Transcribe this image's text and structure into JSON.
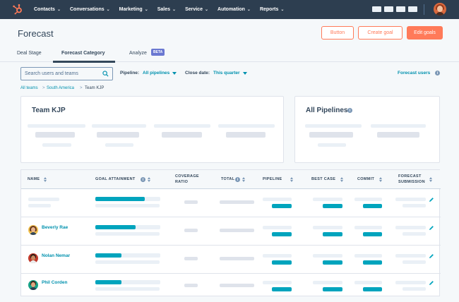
{
  "nav": {
    "items": [
      {
        "label": "Contacts"
      },
      {
        "label": "Conversations"
      },
      {
        "label": "Marketing"
      },
      {
        "label": "Sales"
      },
      {
        "label": "Service"
      },
      {
        "label": "Automation"
      },
      {
        "label": "Reports"
      }
    ]
  },
  "header": {
    "title": "Forecast",
    "button_label": "Button",
    "create_goal_label": "Create goal",
    "edit_goals_label": "Edit goals"
  },
  "tabs": {
    "deal_stage": "Deal Stage",
    "forecast_category": "Forecast Category",
    "analyze": "Analyze",
    "beta": "BETA"
  },
  "filters": {
    "search_placeholder": "Search users and teams",
    "pipeline_label": "Pipeline:",
    "pipeline_value": "All pipelines",
    "close_date_label": "Close date:",
    "close_date_value": "This quarter",
    "forecast_users": "Forecast users"
  },
  "breadcrumb": {
    "all_teams": "All teams",
    "region": "South America",
    "team": "Team KJP"
  },
  "cards": {
    "team_title": "Team KJP",
    "pipelines_title": "All Pipelines"
  },
  "table": {
    "headers": {
      "name": "NAME",
      "goal_attainment": "GOAL ATTAINMENT",
      "coverage_ratio_1": "COVERAGE",
      "coverage_ratio_2": "RATIO",
      "total": "TOTAL",
      "pipeline": "PIPELINE",
      "best_case": "BEST CASE",
      "commit": "COMMIT",
      "forecast_submission_1": "FORECAST",
      "forecast_submission_2": "SUBMISSION"
    },
    "rows": [
      {
        "name": "",
        "goal_progress": 0.76
      },
      {
        "name": "Beverly Rae",
        "goal_progress": 0.62
      },
      {
        "name": "Nolan Nemar",
        "goal_progress": 0.4
      },
      {
        "name": "Phil Corden",
        "goal_progress": 0.4
      }
    ]
  },
  "colors": {
    "nav_bg": "#2d3e50",
    "accent_orange": "#ff7a59",
    "link_teal": "#0091ae",
    "progress_teal": "#00a4bd",
    "beta_purple": "#6a78d1"
  }
}
